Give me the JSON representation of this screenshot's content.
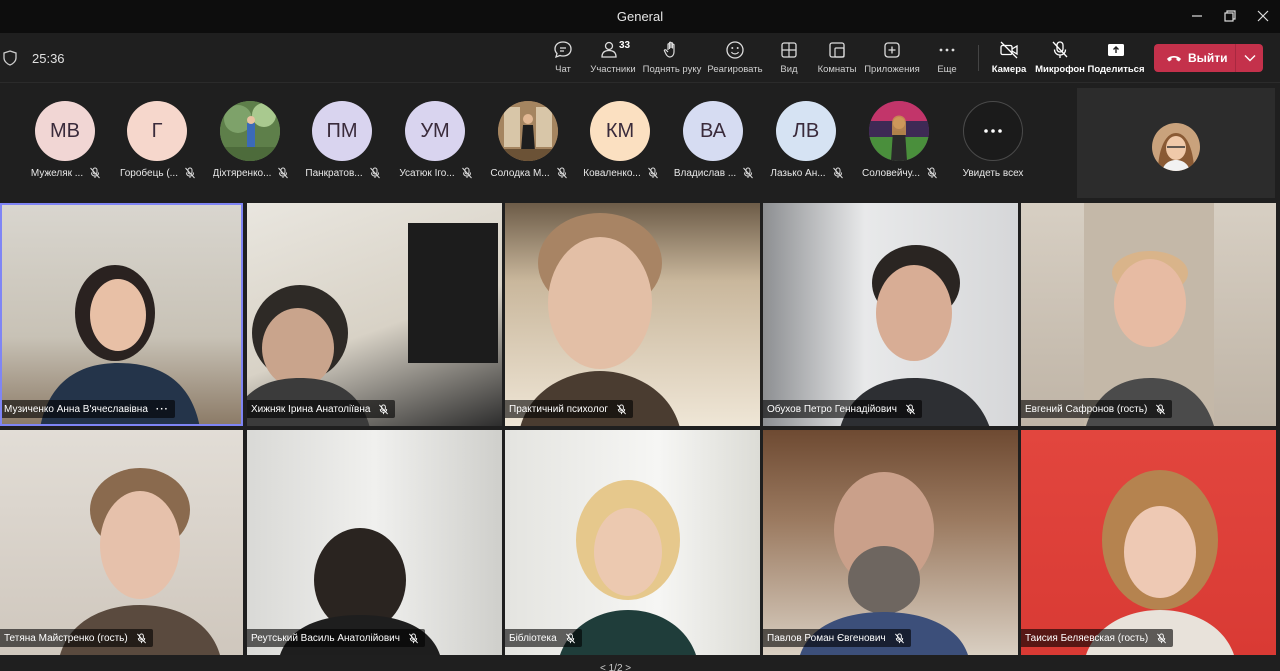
{
  "window": {
    "title": "General"
  },
  "toolbar": {
    "timer": "25:36",
    "participants_count": "33",
    "buttons": [
      {
        "label": "Чат",
        "icon": "chat-icon"
      },
      {
        "label": "Участники",
        "icon": "people-icon"
      },
      {
        "label": "Поднять руку",
        "icon": "hand-icon"
      },
      {
        "label": "Реагировать",
        "icon": "smile-icon"
      },
      {
        "label": "Вид",
        "icon": "view-icon"
      },
      {
        "label": "Комнаты",
        "icon": "rooms-icon"
      },
      {
        "label": "Приложения",
        "icon": "plus-icon"
      },
      {
        "label": "Еще",
        "icon": "more-icon"
      }
    ],
    "camera_label": "Камера",
    "mic_label": "Микрофон",
    "share_label": "Поделиться",
    "leave_label": "Выйти"
  },
  "strip": {
    "participants": [
      {
        "initials": "МВ",
        "name": "Мужеляк ...",
        "color": "#f1d6d4"
      },
      {
        "initials": "Г",
        "name": "Горобець (...",
        "color": "#f6d7cc"
      },
      {
        "initials": "",
        "name": "Діхтяренко...",
        "color": "#6e8f5a"
      },
      {
        "initials": "ПМ",
        "name": "Панкратов...",
        "color": "#d9d4ef"
      },
      {
        "initials": "УМ",
        "name": "Усатюк Іго...",
        "color": "#d9d4ef"
      },
      {
        "initials": "",
        "name": "Солодка М...",
        "color": "#8b6a4c"
      },
      {
        "initials": "КМ",
        "name": "Коваленко...",
        "color": "#fbe0c1"
      },
      {
        "initials": "ВА",
        "name": "Владислав ...",
        "color": "#d6dcf2"
      },
      {
        "initials": "ЛВ",
        "name": "Лазько Ан...",
        "color": "#d6e3f3"
      },
      {
        "initials": "",
        "name": "Соловейчу...",
        "color": "#8c3b6e"
      }
    ],
    "see_all": "Увидеть всех"
  },
  "grid": {
    "tiles": [
      {
        "name": "Музиченко Анна В'ячеславівна",
        "more": "···",
        "active": true
      },
      {
        "name": "Хижняк Ірина Анатоліївна"
      },
      {
        "name": "Практичний психолог"
      },
      {
        "name": "Обухов Петро Геннадійович"
      },
      {
        "name": "Евгений Сафронов (гость)"
      },
      {
        "name": "Тетяна Майстренко (гость)"
      },
      {
        "name": "Реутський Василь Анатолійович"
      },
      {
        "name": "Бібліотека"
      },
      {
        "name": "Павлов Роман Євгенович"
      },
      {
        "name": "Таисия Беляевская (гость)"
      }
    ]
  },
  "pager": "< 1/2 >",
  "colors": {
    "leave": "#c4314b",
    "active_border": "#7f85f5"
  }
}
